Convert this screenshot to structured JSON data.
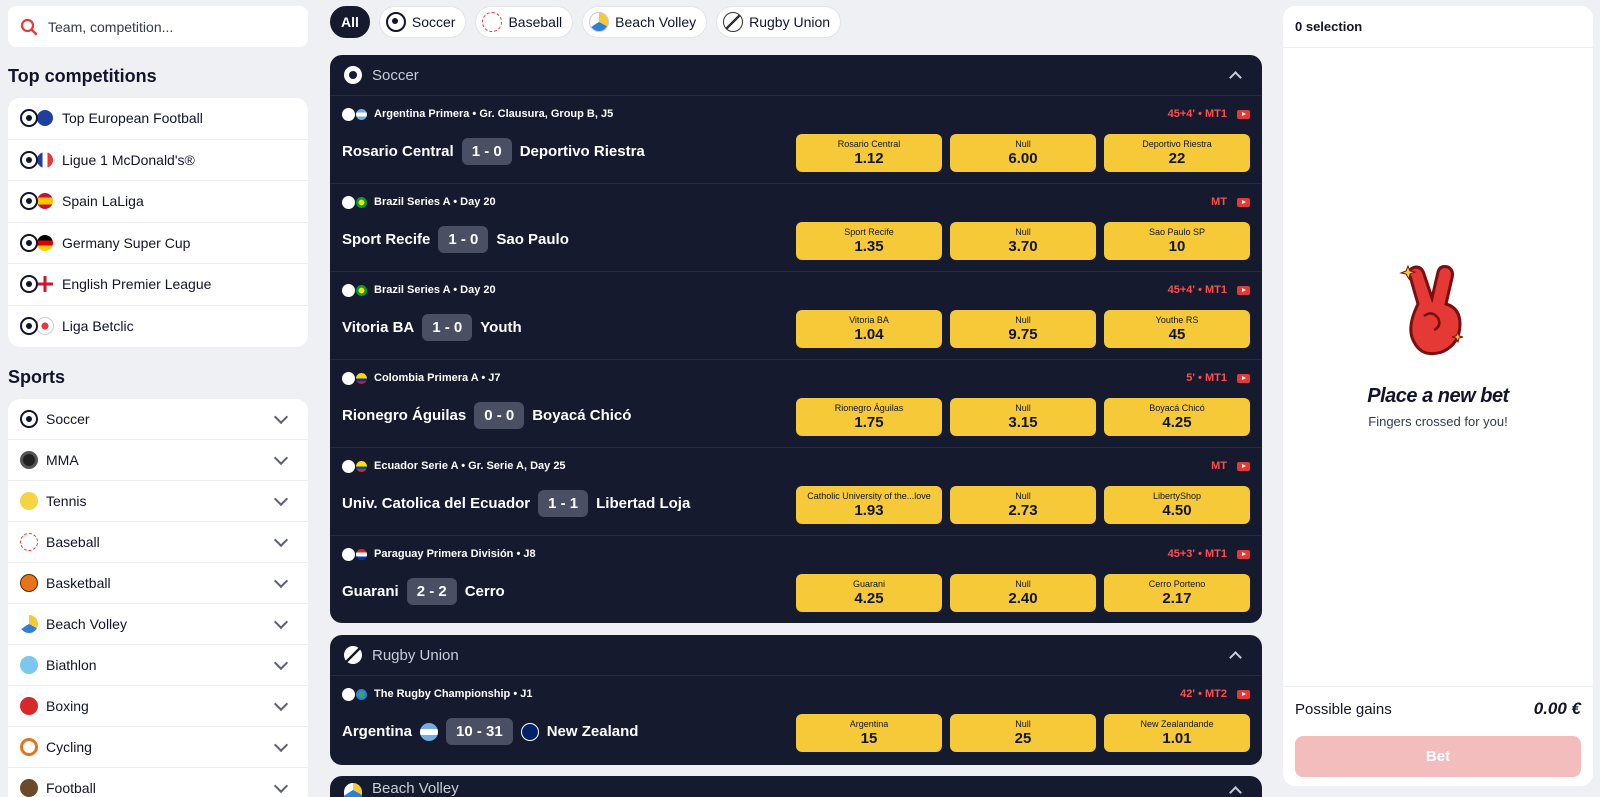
{
  "search": {
    "placeholder": "Team, competition..."
  },
  "top_competitions": {
    "title": "Top competitions",
    "items": [
      {
        "label": "Top European Football",
        "flag": "eu"
      },
      {
        "label": "Ligue 1 McDonald's®",
        "flag": "fr"
      },
      {
        "label": "Spain LaLiga",
        "flag": "es"
      },
      {
        "label": "Germany Super Cup",
        "flag": "de"
      },
      {
        "label": "English Premier League",
        "flag": "en"
      },
      {
        "label": "Liga Betclic",
        "flag": "pt"
      }
    ]
  },
  "sports": {
    "title": "Sports",
    "items": [
      {
        "label": "Soccer",
        "icon": "soccer-icon"
      },
      {
        "label": "MMA",
        "icon": "mma-icon"
      },
      {
        "label": "Tennis",
        "icon": "tennis-icon"
      },
      {
        "label": "Baseball",
        "icon": "baseball-icon"
      },
      {
        "label": "Basketball",
        "icon": "basketball-icon"
      },
      {
        "label": "Beach Volley",
        "icon": "beach-volley-icon"
      },
      {
        "label": "Biathlon",
        "icon": "biathlon-icon"
      },
      {
        "label": "Boxing",
        "icon": "boxing-icon"
      },
      {
        "label": "Cycling",
        "icon": "cycling-icon"
      },
      {
        "label": "Football",
        "icon": "football-icon"
      }
    ]
  },
  "filters": [
    {
      "label": "All"
    },
    {
      "label": "Soccer"
    },
    {
      "label": "Baseball"
    },
    {
      "label": "Beach Volley"
    },
    {
      "label": "Rugby Union"
    }
  ],
  "soccer": {
    "title": "Soccer",
    "events": [
      {
        "comp": "Argentina Primera • Gr. Clausura, Group B, J5",
        "live": "45+4' • MT1",
        "home": "Rosario Central",
        "score": "1 - 0",
        "away": "Deportivo Riestra",
        "odds": [
          {
            "label": "Rosario Central",
            "value": "1.12"
          },
          {
            "label": "Null",
            "value": "6.00"
          },
          {
            "label": "Deportivo Riestra",
            "value": "22"
          }
        ]
      },
      {
        "comp": "Brazil Series A • Day 20",
        "live": "MT",
        "home": "Sport Recife",
        "score": "1 - 0",
        "away": "Sao Paulo",
        "odds": [
          {
            "label": "Sport Recife",
            "value": "1.35"
          },
          {
            "label": "Null",
            "value": "3.70"
          },
          {
            "label": "Sao Paulo SP",
            "value": "10"
          }
        ]
      },
      {
        "comp": "Brazil Series A • Day 20",
        "live": "45+4' • MT1",
        "home": "Vitoria BA",
        "score": "1 - 0",
        "away": "Youth",
        "odds": [
          {
            "label": "Vitoria BA",
            "value": "1.04"
          },
          {
            "label": "Null",
            "value": "9.75"
          },
          {
            "label": "Youthe RS",
            "value": "45"
          }
        ]
      },
      {
        "comp": "Colombia Primera A • J7",
        "live": "5' • MT1",
        "home": "Rionegro Águilas",
        "score": "0 - 0",
        "away": "Boyacá Chicó",
        "odds": [
          {
            "label": "Rionegro Águilas",
            "value": "1.75"
          },
          {
            "label": "Null",
            "value": "3.15"
          },
          {
            "label": "Boyacá Chicó",
            "value": "4.25"
          }
        ]
      },
      {
        "comp": "Ecuador Serie A • Gr. Serie A, Day 25",
        "live": "MT",
        "home": "Univ. Catolica del Ecuador",
        "score": "1 - 1",
        "away": "Libertad Loja",
        "odds": [
          {
            "label": "Catholic University of the...love",
            "value": "1.93"
          },
          {
            "label": "Null",
            "value": "2.73"
          },
          {
            "label": "LibertyShop",
            "value": "4.50"
          }
        ]
      },
      {
        "comp": "Paraguay Primera División • J8",
        "live": "45+3' • MT1",
        "home": "Guarani",
        "score": "2 - 2",
        "away": "Cerro",
        "odds": [
          {
            "label": "Guarani",
            "value": "4.25"
          },
          {
            "label": "Null",
            "value": "2.40"
          },
          {
            "label": "Cerro Porteno",
            "value": "2.17"
          }
        ]
      }
    ]
  },
  "rugby": {
    "title": "Rugby Union",
    "events": [
      {
        "comp": "The Rugby Championship • J1",
        "live": "42' • MT2",
        "home": "Argentina",
        "score": "10 - 31",
        "away": "New Zealand",
        "odds": [
          {
            "label": "Argentina",
            "value": "15"
          },
          {
            "label": "Null",
            "value": "25"
          },
          {
            "label": "New Zealandande",
            "value": "1.01"
          }
        ]
      }
    ]
  },
  "beach": {
    "title": "Beach Volley"
  },
  "betslip": {
    "selection": "0 selection",
    "empty_title": "Place a new bet",
    "empty_sub": "Fingers crossed for you!",
    "gains_label": "Possible gains",
    "gains_value": "0.00 €",
    "bet_label": "Bet"
  },
  "colors": {
    "accent": "#f5c938",
    "dark": "#161a2e",
    "live": "#ff4d4d",
    "bet_disabled": "#f4bdbd"
  }
}
